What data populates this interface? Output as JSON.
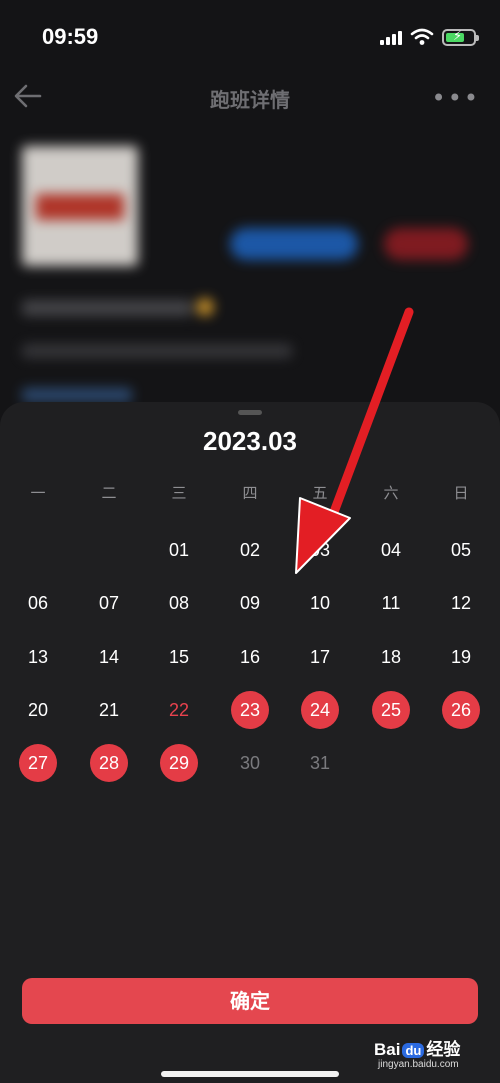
{
  "status_bar": {
    "time": "09:59"
  },
  "header": {
    "title": "跑班详情",
    "more": "•••"
  },
  "calendar": {
    "month_label": "2023.03",
    "weekdays": [
      "一",
      "二",
      "三",
      "四",
      "五",
      "六",
      "日"
    ],
    "weeks": [
      [
        null,
        null,
        {
          "d": "01"
        },
        {
          "d": "02"
        },
        {
          "d": "03"
        },
        {
          "d": "04"
        },
        {
          "d": "05"
        }
      ],
      [
        {
          "d": "06"
        },
        {
          "d": "07"
        },
        {
          "d": "08"
        },
        {
          "d": "09"
        },
        {
          "d": "10"
        },
        {
          "d": "11"
        },
        {
          "d": "12"
        }
      ],
      [
        {
          "d": "13"
        },
        {
          "d": "14"
        },
        {
          "d": "15"
        },
        {
          "d": "16"
        },
        {
          "d": "17"
        },
        {
          "d": "18"
        },
        {
          "d": "19"
        }
      ],
      [
        {
          "d": "20"
        },
        {
          "d": "21"
        },
        {
          "d": "22",
          "state": "today"
        },
        {
          "d": "23",
          "state": "selected"
        },
        {
          "d": "24",
          "state": "selected"
        },
        {
          "d": "25",
          "state": "selected"
        },
        {
          "d": "26",
          "state": "selected"
        }
      ],
      [
        {
          "d": "27",
          "state": "selected"
        },
        {
          "d": "28",
          "state": "selected"
        },
        {
          "d": "29",
          "state": "selected"
        },
        {
          "d": "30",
          "state": "disabled"
        },
        {
          "d": "31",
          "state": "disabled"
        },
        null,
        null
      ]
    ],
    "confirm_label": "确定"
  },
  "colors": {
    "accent": "#e4474f",
    "today_text": "#e8424e",
    "annotation_arrow": "#e31e24"
  },
  "watermark": {
    "brand_left": "Bai",
    "brand_mid": "du",
    "brand_right": "经验",
    "url": "jingyan.baidu.com"
  }
}
